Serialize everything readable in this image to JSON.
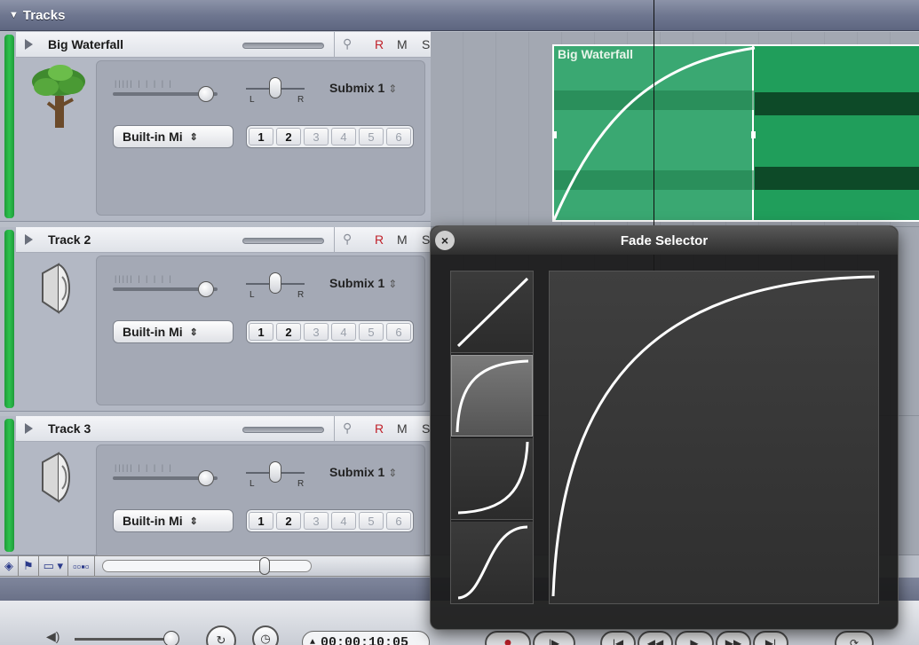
{
  "header": {
    "title": "Tracks"
  },
  "tracks": [
    {
      "name": "Big Waterfall",
      "icon": "tree-icon",
      "rec_label": "R",
      "mute_label": "M",
      "solo_label": "S",
      "submix": "Submix 1",
      "input": "Built-in Mi",
      "pan_left": "L",
      "pan_right": "R",
      "channels": [
        "1",
        "2",
        "3",
        "4",
        "5",
        "6"
      ]
    },
    {
      "name": "Track 2",
      "icon": "speaker-icon",
      "rec_label": "R",
      "mute_label": "M",
      "solo_label": "S",
      "submix": "Submix 1",
      "input": "Built-in Mi",
      "pan_left": "L",
      "pan_right": "R",
      "channels": [
        "1",
        "2",
        "3",
        "4",
        "5",
        "6"
      ]
    },
    {
      "name": "Track 3",
      "icon": "speaker-icon",
      "rec_label": "R",
      "mute_label": "M",
      "solo_label": "S",
      "submix": "Submix 1",
      "input": "Built-in Mi",
      "pan_left": "L",
      "pan_right": "R",
      "channels": [
        "1",
        "2",
        "3",
        "4",
        "5",
        "6"
      ]
    }
  ],
  "region": {
    "title": "Big Waterfall",
    "color": "#209e5b",
    "fade_color": "#3aa872"
  },
  "fade_selector": {
    "title": "Fade Selector",
    "close_glyph": "×",
    "options": [
      "linear-fade",
      "fast-fade",
      "slow-fade",
      "s-curve-fade"
    ],
    "selected_index": 1
  },
  "transport": {
    "timecode": "00:00:10:05",
    "timecode_arrows": "▲",
    "buttons": [
      "record",
      "play-from-start",
      "go-to-start",
      "rewind",
      "play",
      "fast-forward",
      "go-to-end",
      "cycle"
    ]
  },
  "mini_toolbar": {
    "items": [
      "snap-icon",
      "flag-icon",
      "ruler-icon",
      "waveform-zoom-icon"
    ]
  },
  "colors": {
    "track_green": "#2dc24d",
    "record_red": "#c0212a"
  }
}
